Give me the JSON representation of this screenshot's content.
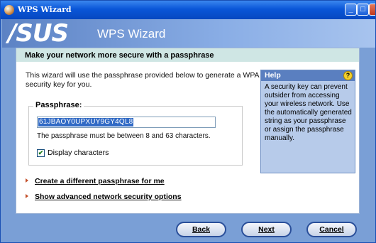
{
  "window": {
    "title": "WPS Wizard",
    "controls": {
      "minimize": "_",
      "maximize": "□",
      "close": "X"
    }
  },
  "header": {
    "logo": "/SUS",
    "wizard_title": "WPS Wizard"
  },
  "banner": {
    "text": "Make your network more secure with a passphrase"
  },
  "intro": {
    "text": "This wizard will use the passphrase provided below to generate a WPA security key for you."
  },
  "help": {
    "title": "Help",
    "icon": "?",
    "text": "A security key can prevent outsider from accessing your wireless network. Use the automatically generated string as your passphrase or assign the passphrase manually."
  },
  "passphrase": {
    "label": "Passphrase:",
    "value": "61JBAOY0UPXUY9GY4QL8",
    "note": "The passphrase must be between 8 and 63 characters.",
    "display_checkbox": {
      "label": "Display characters",
      "checked": true,
      "mark": "✔"
    }
  },
  "links": {
    "create": "Create a different passphrase for me",
    "advanced": "Show advanced network security options"
  },
  "buttons": {
    "back": "Back",
    "next": "Next",
    "cancel": "Cancel"
  },
  "colors": {
    "title_bar": "#0a56d8",
    "banner": "#cfe6e4",
    "help_panel": "#b7cbea",
    "link_arrow": "#c4502a"
  }
}
